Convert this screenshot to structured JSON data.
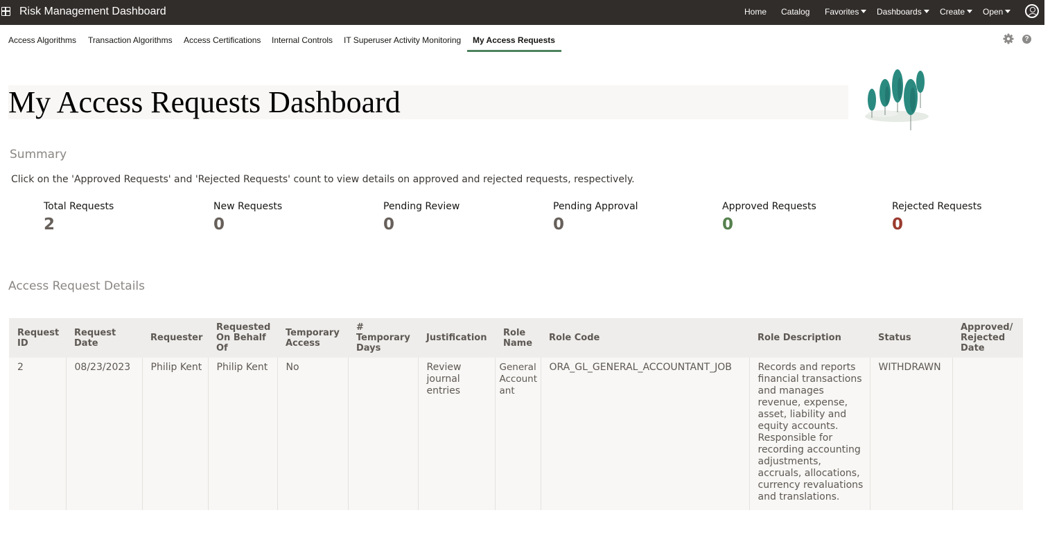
{
  "topbar": {
    "app_title": "Risk Management Dashboard",
    "nav": [
      "Home",
      "Catalog",
      "Favorites",
      "Dashboards",
      "Create",
      "Open"
    ]
  },
  "tabs": [
    "Access Algorithms",
    "Transaction Algorithms",
    "Access Certifications",
    "Internal Controls",
    "IT Superuser Activity Monitoring",
    "My Access Requests"
  ],
  "page_title": "My Access Requests Dashboard",
  "summary": {
    "title": "Summary",
    "instruction": "Click on the 'Approved Requests' and 'Rejected Requests' count to view details on approved and rejected requests, respectively.",
    "metrics": [
      {
        "label": "Total Requests",
        "value": "2"
      },
      {
        "label": "New Requests",
        "value": "0"
      },
      {
        "label": "Pending Review",
        "value": "0"
      },
      {
        "label": "Pending Approval",
        "value": "0"
      },
      {
        "label": "Approved Requests",
        "value": "0"
      },
      {
        "label": "Rejected Requests",
        "value": "0"
      }
    ]
  },
  "details": {
    "title": "Access Request Details",
    "columns": [
      "Request ID",
      "Request Date",
      "Requester",
      "Requested On Behalf Of",
      "Temporary Access",
      "# Temporary Days",
      "Justification",
      "Role Name",
      "Role Code",
      "Role Description",
      "Status",
      "Approved/ Rejected Date"
    ],
    "rows": [
      [
        "2",
        "08/23/2023",
        "Philip Kent",
        "Philip Kent",
        "No",
        "",
        "Review journal entries",
        "General Accountant",
        "ORA_GL_GENERAL_ACCOUNTANT_JOB",
        "Records and reports financial transactions and manages revenue, expense, asset, liability and equity accounts. Responsible for recording accounting adjustments, accruals, allocations, currency revaluations and translations.",
        "WITHDRAWN",
        ""
      ]
    ]
  },
  "colors": {
    "topbar": "#312d2a",
    "active_tab_underline": "#4c825c",
    "approved": "#55804d",
    "rejected": "#9b3a2f",
    "metric": "#665f5a"
  }
}
